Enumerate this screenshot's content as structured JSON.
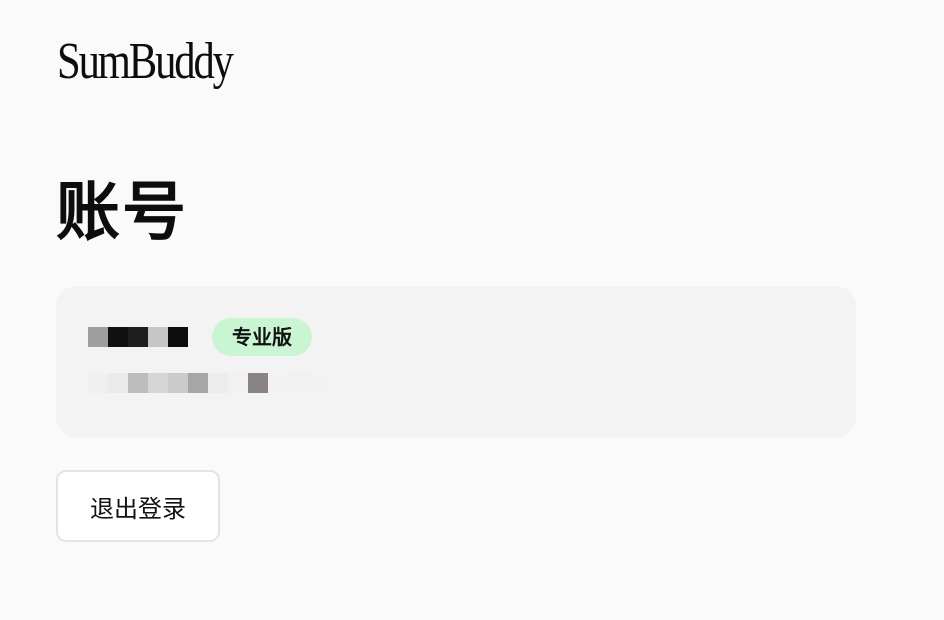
{
  "brand": {
    "logo_text": "SumBuddy"
  },
  "page": {
    "title": "账号"
  },
  "account": {
    "plan_badge": "专业版",
    "redacted_name_colors": [
      "#9e9e9e",
      "#111111",
      "#1e1e1e",
      "#c6c6c6",
      "#0d0d0d"
    ],
    "redacted_email_colors": [
      "#efefef",
      "#ebebeb",
      "#bfbcbc",
      "#d6d5d5",
      "#cdcaca",
      "#a8a5a5",
      "#ececec",
      "#f1f1f1",
      "#8a8584",
      "#f2f2f2",
      "#f1f1f1",
      "#f2f2f2"
    ]
  },
  "actions": {
    "logout_label": "退出登录"
  }
}
